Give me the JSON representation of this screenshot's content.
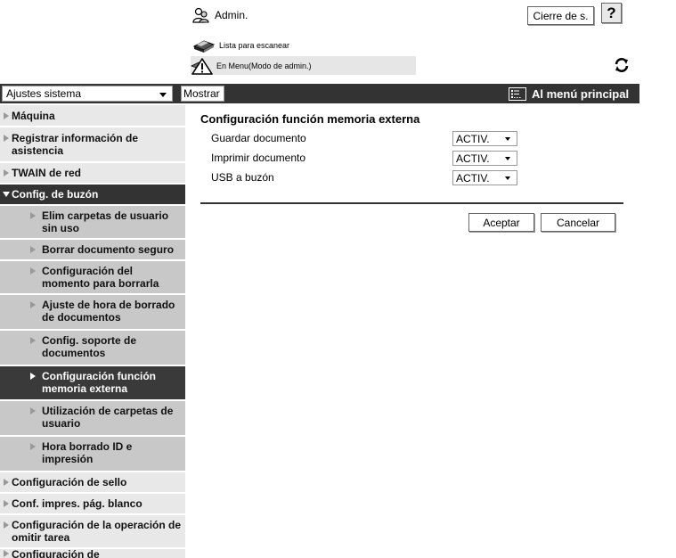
{
  "header": {
    "user_label": "Admin.",
    "logout_label": "Cierre de s.",
    "help_label": "?",
    "scan_list_label": "Lista para escanear",
    "mode_status": "En Menu(Modo de admin.)"
  },
  "bar": {
    "category_value": "Ajustes sistema",
    "show_label": "Mostrar",
    "main_menu_label": "Al menú principal"
  },
  "sidebar": {
    "items": [
      {
        "label": "Máquina"
      },
      {
        "label": "Registrar información de asistencia"
      },
      {
        "label": "TWAIN de red"
      },
      {
        "label": "Config. de buzón"
      },
      {
        "label": "Elim carpetas de usuario sin uso"
      },
      {
        "label": "Borrar documento seguro"
      },
      {
        "label": "Configuración del momento para borrarla"
      },
      {
        "label": "Ajuste de hora de borrado de documentos"
      },
      {
        "label": "Config. soporte de documentos"
      },
      {
        "label": "Configuración función memoria externa"
      },
      {
        "label": "Utilización de carpetas de usuario"
      },
      {
        "label": "Hora borrado ID e impresión"
      },
      {
        "label": "Configuración de sello"
      },
      {
        "label": "Conf. impres. pág. blanco"
      },
      {
        "label": "Configuración de la operación de omitir tarea"
      },
      {
        "label": "Configuración de"
      }
    ]
  },
  "main": {
    "title": "Configuración función memoria externa",
    "settings": [
      {
        "label": "Guardar documento",
        "value": "ACTIV."
      },
      {
        "label": "Imprimir documento",
        "value": "ACTIV."
      },
      {
        "label": "USB a buzón",
        "value": "ACTIV."
      }
    ],
    "ok_label": "Aceptar",
    "cancel_label": "Cancelar"
  },
  "colors": {
    "bar": "#333333",
    "nav_bg": "#e8e8e8",
    "nav_sub_bg": "#c8c8c8",
    "nav_active_bg": "#3a3a3a"
  }
}
